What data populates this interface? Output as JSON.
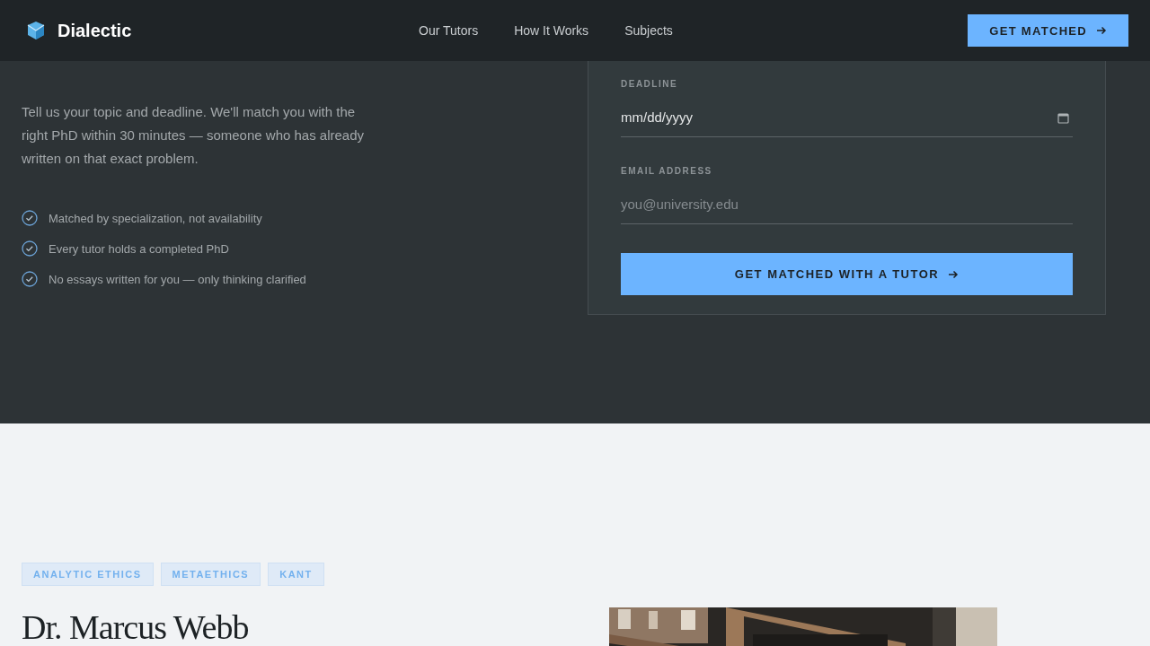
{
  "nav": {
    "brand": "Dialectic",
    "links": [
      "Our Tutors",
      "How It Works",
      "Subjects"
    ],
    "cta": "GET MATCHED"
  },
  "hero": {
    "intro": "Tell us your topic and deadline. We'll match you with the right PhD within 30 minutes — someone who has already written on that exact problem.",
    "points": [
      "Matched by specialization, not availability",
      "Every tutor holds a completed PhD",
      "No essays written for you — only thinking clarified"
    ]
  },
  "form": {
    "fields": [
      {
        "kind": "date",
        "label": "DEADLINE",
        "value": "mm/dd/yyyy"
      },
      {
        "kind": "email",
        "label": "EMAIL ADDRESS",
        "placeholder": "you@university.edu"
      }
    ],
    "submit": "GET MATCHED WITH A TUTOR"
  },
  "tutor": {
    "tags": [
      "ANALYTIC ETHICS",
      "METAETHICS",
      "KANT"
    ],
    "name": "Dr. Marcus Webb"
  }
}
